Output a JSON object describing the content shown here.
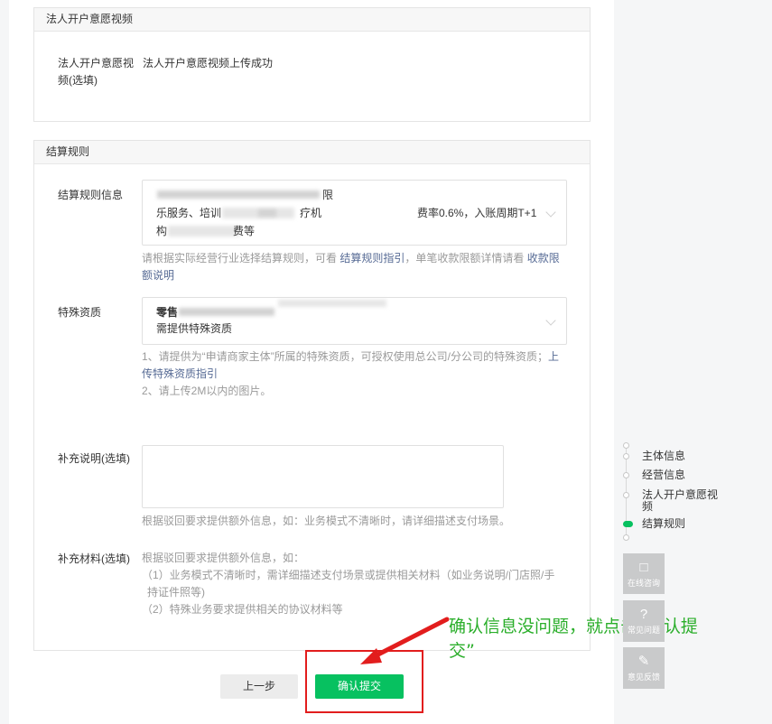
{
  "section_video": {
    "header": "法人开户意愿视频",
    "label_line1": "法人开户意愿视",
    "label_line2": "频(选填)",
    "value": "法人开户意愿视频上传成功"
  },
  "section_settlement": {
    "header": "结算规则",
    "rule_label": "结算规则信息",
    "rule_line1_end": "限",
    "rule_line2_start": "乐服务、培训",
    "rule_line2_end": "疗机",
    "rule_line3_start": "构",
    "rule_line3_end": "费等",
    "rule_rate": "费率0.6%，入账周期T+1",
    "rule_hint_prefix": "请根据实际经营行业选择结算规则，可看",
    "rule_hint_link1": "结算规则指引",
    "rule_hint_mid": "，单笔收款限额详情请看",
    "rule_hint_link2_a": "收款限",
    "rule_hint_link2_b": "额说明",
    "qual_label": "特殊资质",
    "qual_line1": "零售",
    "qual_line2": "需提供特殊资质",
    "qual_hint1_a": "1、请提供为“申请商家主体”所属的特殊资质，可授权使用总公司/分公司的特殊资质；",
    "qual_hint1_link_a": "上",
    "qual_hint1_link_b": "传特殊资质指引",
    "qual_hint2": "2、请上传2M以内的图片。",
    "supp_label": "补充说明(选填)",
    "supp_hint": "根据驳回要求提供额外信息，如：业务模式不清晰时，请详细描述支付场景。",
    "material_label": "补充材料(选填)",
    "material_hint1": "根据驳回要求提供额外信息，如：",
    "material_hint2": "（1）业务模式不清晰时，需详细描述支付场景或提供相关材料（如业务说明/门店照/手",
    "material_hint3": "持证件照等)",
    "material_hint4": "（2）特殊业务要求提供相关的协议材料等"
  },
  "buttons": {
    "prev": "上一步",
    "submit": "确认提交"
  },
  "annotation": {
    "line1": "确认信息没问题，就点击“确认提",
    "line2": "交”"
  },
  "steps": [
    {
      "label": "主体信息"
    },
    {
      "label": "经营信息"
    },
    {
      "label_line1": "法人开户意愿视",
      "label_line2": "频"
    },
    {
      "label": "结算规则"
    }
  ],
  "side_buttons": {
    "consult": "在线咨询",
    "help": "常见问题",
    "feedback": "意见反馈"
  },
  "colors": {
    "accent": "#07c160",
    "link": "#576b95",
    "annotation": "#2aae2a",
    "highlight": "#e21d1d"
  }
}
